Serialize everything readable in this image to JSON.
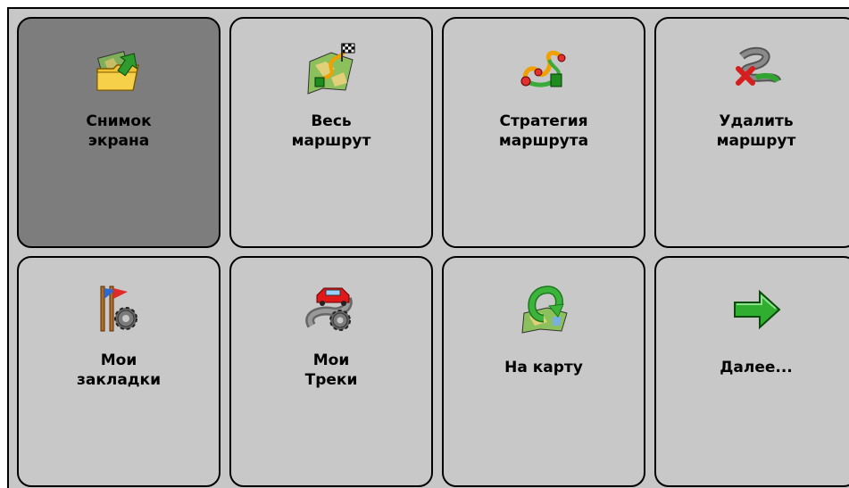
{
  "menu": {
    "tiles": [
      {
        "label": "Снимок\nэкрана",
        "icon": "screenshot-folder-icon",
        "active": true
      },
      {
        "label": "Весь\nмаршрут",
        "icon": "whole-route-map-icon",
        "active": false
      },
      {
        "label": "Стратегия\nмаршрута",
        "icon": "route-strategy-icon",
        "active": false
      },
      {
        "label": "Удалить\nмаршрут",
        "icon": "delete-route-icon",
        "active": false
      },
      {
        "label": "Мои\nзакладки",
        "icon": "bookmarks-flags-gear-icon",
        "active": false
      },
      {
        "label": "Мои\nТреки",
        "icon": "tracks-car-gear-icon",
        "active": false
      },
      {
        "label": "На карту",
        "icon": "back-to-map-icon",
        "active": false
      },
      {
        "label": "Далее...",
        "icon": "next-arrow-icon",
        "active": false
      }
    ]
  },
  "colors": {
    "tile_background": "#c8c8c8",
    "tile_active_background": "#7d7d7d",
    "frame_background": "#c7c7c7"
  }
}
